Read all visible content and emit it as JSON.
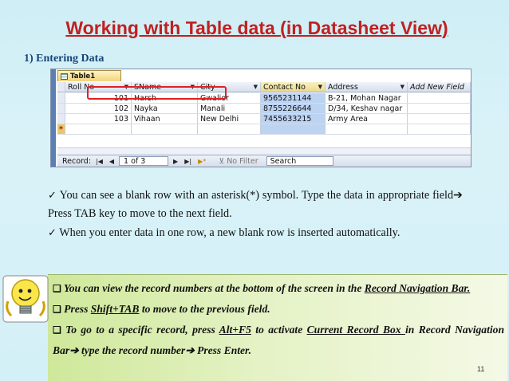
{
  "slide": {
    "title": "Working with Table data (in Datasheet View)",
    "section": "1) Entering Data",
    "page_number": "11"
  },
  "datasheet": {
    "tab_label": "Table1",
    "columns": [
      "Roll No",
      "SName",
      "City",
      "Contact No",
      "Address",
      "Add New Field"
    ],
    "rows": [
      [
        "101",
        "Harsh",
        "Gwalior",
        "9565231144",
        "B-21, Mohan Nagar"
      ],
      [
        "102",
        "Nayka",
        "Manali",
        "8755226644",
        "D/34, Keshav nagar"
      ],
      [
        "103",
        "Vihaan",
        "New Delhi",
        "7455633215",
        "Army Area"
      ]
    ],
    "new_row_marker": "*",
    "navigation": {
      "record_label": "Record:",
      "current_record": "1 of 3",
      "filter_label": "No Filter",
      "search_placeholder": "Search"
    }
  },
  "bullets": {
    "b1_a": "You can see a blank row with an asterisk(*) symbol. Type the data in appropriate field",
    "b1_b": " Press TAB key to move to the next field.",
    "b2": "When you enter data in one row, a new blank row is inserted automatically."
  },
  "tips": {
    "t1_a": "You can view the record numbers at the bottom of the screen in the ",
    "t1_link": "Record Navigation Bar.",
    "t2_a": "Press ",
    "t2_key": "Shift+TAB",
    "t2_b": " to move to the previous field.",
    "t3_a": "To go to a specific record, press ",
    "t3_key": "Alt+F5",
    "t3_b": " to activate ",
    "t3_link": "Current Record Box ",
    "t3_c": "in Record Navigation Bar",
    "t3_d": "type the record number",
    "t3_e": "Press Enter."
  },
  "icons": {
    "check": "checkmark-icon",
    "arrow": "arrow-right-icon",
    "box": "square-bullet-icon",
    "bulb": "lightbulb-icon"
  },
  "colors": {
    "title": "#c02020",
    "section": "#16457a",
    "highlight_frame": "#e02020"
  }
}
